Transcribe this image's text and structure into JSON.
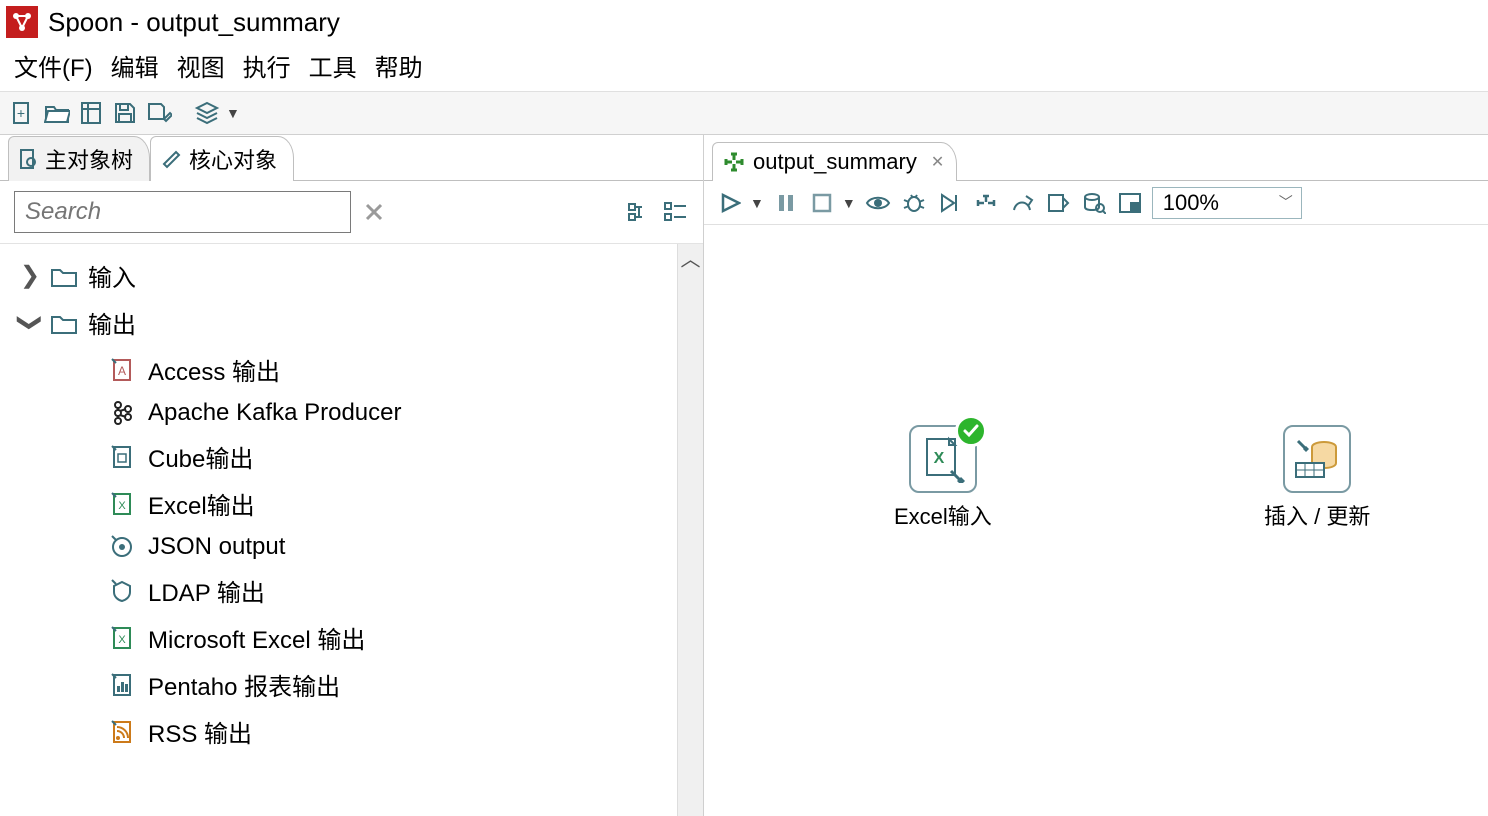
{
  "title": "Spoon - output_summary",
  "menu": [
    "文件(F)",
    "编辑",
    "视图",
    "执行",
    "工具",
    "帮助"
  ],
  "left_tabs": {
    "tree": "主对象树",
    "core": "核心对象"
  },
  "search": {
    "placeholder": "Search"
  },
  "tree": {
    "input": "输入",
    "output": "输出",
    "output_children": [
      "Access 输出",
      "Apache Kafka Producer",
      "Cube输出",
      "Excel输出",
      "JSON output",
      "LDAP 输出",
      "Microsoft Excel 输出",
      "Pentaho 报表输出",
      "RSS 输出"
    ]
  },
  "canvas_tab": "output_summary",
  "zoom": "100%",
  "steps": {
    "excel_input": "Excel输入",
    "insert_update": "插入 / 更新"
  }
}
